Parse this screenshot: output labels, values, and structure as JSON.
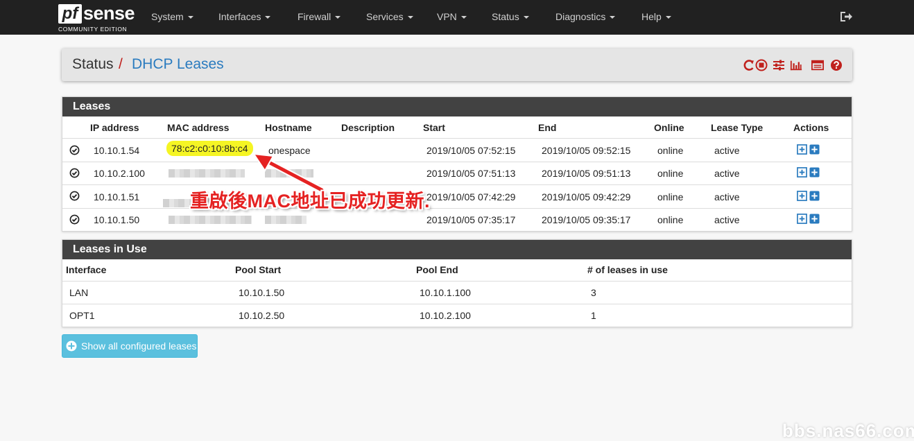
{
  "brand": {
    "logo_pf": "pf",
    "logo_sense": "sense",
    "edition": "COMMUNITY EDITION"
  },
  "nav": [
    {
      "label": "System"
    },
    {
      "label": "Interfaces"
    },
    {
      "label": "Firewall"
    },
    {
      "label": "Services"
    },
    {
      "label": "VPN"
    },
    {
      "label": "Status"
    },
    {
      "label": "Diagnostics"
    },
    {
      "label": "Help"
    }
  ],
  "breadcrumb": {
    "parent": "Status",
    "separator": "/",
    "current": "DHCP Leases"
  },
  "toolbar_icons": [
    "reload-icon",
    "stop-icon",
    "settings-sliders-icon",
    "bar-chart-icon",
    "list-log-icon",
    "help-icon"
  ],
  "leases": {
    "title": "Leases",
    "columns": [
      "IP address",
      "MAC address",
      "Hostname",
      "Description",
      "Start",
      "End",
      "Online",
      "Lease Type",
      "Actions"
    ],
    "rows": [
      {
        "ip": "10.10.1.54",
        "mac": "78:c2:c0:10:8b:c4",
        "hostname": "onespace",
        "description": "",
        "start": "2019/10/05 07:52:15",
        "end": "2019/10/05 09:52:15",
        "online": "online",
        "type": "active"
      },
      {
        "ip": "10.10.2.100",
        "mac": "",
        "hostname": "",
        "description": "",
        "start": "2019/10/05 07:51:13",
        "end": "2019/10/05 09:51:13",
        "online": "online",
        "type": "active"
      },
      {
        "ip": "10.10.1.51",
        "mac": "",
        "hostname": "",
        "description": "",
        "start": "2019/10/05 07:42:29",
        "end": "2019/10/05 09:42:29",
        "online": "online",
        "type": "active"
      },
      {
        "ip": "10.10.1.50",
        "mac": "",
        "hostname": "",
        "description": "",
        "start": "2019/10/05 07:35:17",
        "end": "2019/10/05 09:35:17",
        "online": "online",
        "type": "active"
      }
    ]
  },
  "leases_in_use": {
    "title": "Leases in Use",
    "columns": [
      "Interface",
      "Pool Start",
      "Pool End",
      "# of leases in use"
    ],
    "rows": [
      {
        "interface": "LAN",
        "pool_start": "10.10.1.50",
        "pool_end": "10.10.1.100",
        "count": "3"
      },
      {
        "interface": "OPT1",
        "pool_start": "10.10.2.50",
        "pool_end": "10.10.2.100",
        "count": "1"
      }
    ]
  },
  "show_all_button": "Show all configured leases",
  "annotation": "重啟後MAC地址已成功更新.",
  "watermark": "bbs.nas66.com",
  "colors": {
    "navbar": "#212121",
    "panel_heading": "#424242",
    "link_blue": "#2a7bbf",
    "accent_red": "#c0211d",
    "button_info": "#5bc0de",
    "highlight": "#f5f524",
    "annotation_red": "#e52222"
  }
}
